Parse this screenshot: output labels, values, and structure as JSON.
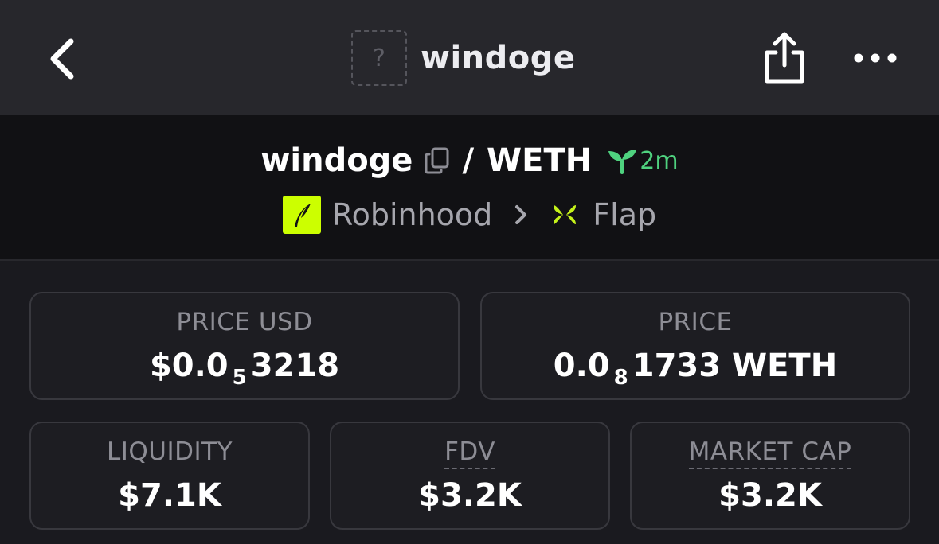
{
  "header": {
    "title": "windoge",
    "token_placeholder": "?",
    "icons": [
      "chevron-left-icon",
      "share-icon",
      "more-icon"
    ]
  },
  "pair": {
    "base": "windoge",
    "separator": "/",
    "quote": "WETH",
    "age": "2m",
    "chain": "Robinhood",
    "dex": "Flap",
    "colors": {
      "age": "#4fd27f",
      "chain_logo_bg": "#ccff00",
      "dex_icon": "#c5f21a"
    }
  },
  "stats": {
    "price_usd": {
      "label": "PRICE USD",
      "prefix": "$0.0",
      "zeros": "5",
      "digits": "3218"
    },
    "price": {
      "label": "PRICE",
      "prefix": "0.0",
      "zeros": "8",
      "digits": "1733 WETH"
    },
    "liquidity": {
      "label": "LIQUIDITY",
      "value": "$7.1K"
    },
    "fdv": {
      "label": "FDV",
      "value": "$3.2K"
    },
    "market_cap": {
      "label": "MARKET CAP",
      "value": "$3.2K"
    }
  }
}
